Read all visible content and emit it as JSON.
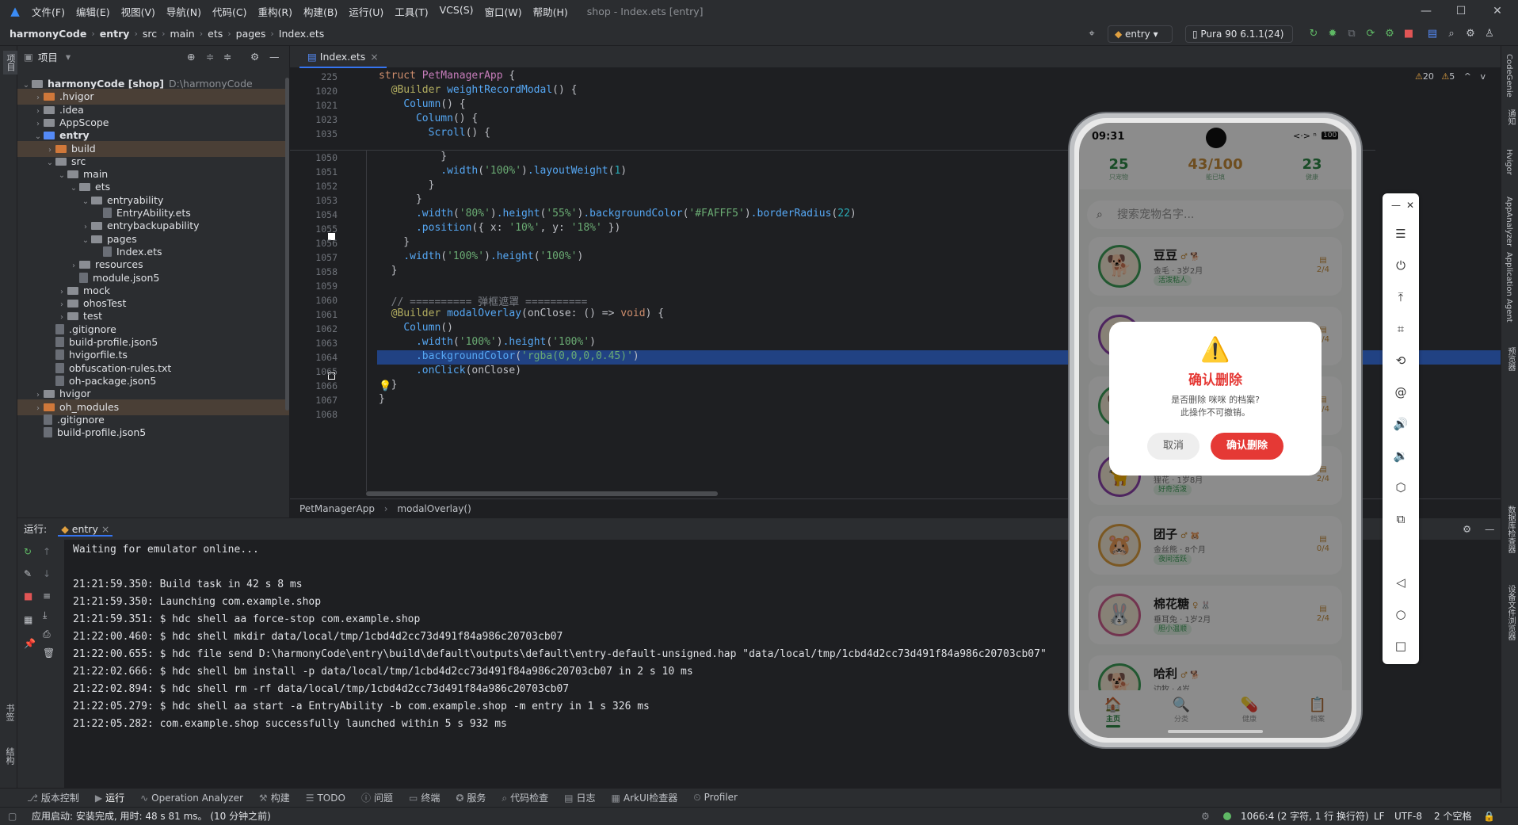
{
  "titlebar": {
    "menus": [
      "文件(F)",
      "编辑(E)",
      "视图(V)",
      "导航(N)",
      "代码(C)",
      "重构(R)",
      "构建(B)",
      "运行(U)",
      "工具(T)",
      "VCS(S)",
      "窗口(W)",
      "帮助(H)"
    ],
    "window_title": "shop - Index.ets [entry]"
  },
  "navbar": {
    "crumbs": [
      "harmonyCode",
      "entry",
      "src",
      "main",
      "ets",
      "pages",
      "Index.ets"
    ],
    "module_select": "entry",
    "device_select": "Pura 90 6.1.1(24)"
  },
  "project": {
    "header": "项目",
    "tree": [
      {
        "label": "harmonyCode [shop]",
        "extra": "D:\\harmonyCode",
        "depth": 0,
        "type": "folder",
        "arrow": "down"
      },
      {
        "label": ".hvigor",
        "depth": 1,
        "type": "folder-orange",
        "arrow": "right",
        "selected": true
      },
      {
        "label": ".idea",
        "depth": 1,
        "type": "folder",
        "arrow": "right"
      },
      {
        "label": "AppScope",
        "depth": 1,
        "type": "folder",
        "arrow": "right"
      },
      {
        "label": "entry",
        "depth": 1,
        "type": "folder-blue",
        "arrow": "down",
        "bold": true
      },
      {
        "label": "build",
        "depth": 2,
        "type": "folder-orange",
        "arrow": "right",
        "selected": true
      },
      {
        "label": "src",
        "depth": 2,
        "type": "folder",
        "arrow": "down"
      },
      {
        "label": "main",
        "depth": 3,
        "type": "folder",
        "arrow": "down"
      },
      {
        "label": "ets",
        "depth": 4,
        "type": "folder",
        "arrow": "down"
      },
      {
        "label": "entryability",
        "depth": 5,
        "type": "folder",
        "arrow": "down"
      },
      {
        "label": "EntryAbility.ets",
        "depth": 6,
        "type": "file",
        "arrow": ""
      },
      {
        "label": "entrybackupability",
        "depth": 5,
        "type": "folder",
        "arrow": "right"
      },
      {
        "label": "pages",
        "depth": 5,
        "type": "folder",
        "arrow": "down"
      },
      {
        "label": "Index.ets",
        "depth": 6,
        "type": "file",
        "arrow": ""
      },
      {
        "label": "resources",
        "depth": 4,
        "type": "folder",
        "arrow": "right"
      },
      {
        "label": "module.json5",
        "depth": 4,
        "type": "file",
        "arrow": ""
      },
      {
        "label": "mock",
        "depth": 3,
        "type": "folder",
        "arrow": "right"
      },
      {
        "label": "ohosTest",
        "depth": 3,
        "type": "folder",
        "arrow": "right"
      },
      {
        "label": "test",
        "depth": 3,
        "type": "folder",
        "arrow": "right"
      },
      {
        "label": ".gitignore",
        "depth": 2,
        "type": "file",
        "arrow": ""
      },
      {
        "label": "build-profile.json5",
        "depth": 2,
        "type": "file",
        "arrow": ""
      },
      {
        "label": "hvigorfile.ts",
        "depth": 2,
        "type": "file",
        "arrow": ""
      },
      {
        "label": "obfuscation-rules.txt",
        "depth": 2,
        "type": "file",
        "arrow": ""
      },
      {
        "label": "oh-package.json5",
        "depth": 2,
        "type": "file",
        "arrow": ""
      },
      {
        "label": "hvigor",
        "depth": 1,
        "type": "folder",
        "arrow": "right"
      },
      {
        "label": "oh_modules",
        "depth": 1,
        "type": "folder-orange",
        "arrow": "right",
        "selected": true
      },
      {
        "label": ".gitignore",
        "depth": 1,
        "type": "file",
        "arrow": ""
      },
      {
        "label": "build-profile.json5",
        "depth": 1,
        "type": "file",
        "arrow": ""
      }
    ]
  },
  "editor": {
    "tab": "Index.ets",
    "inspections": {
      "warnings": "20",
      "weak": "5"
    },
    "sticky": [
      {
        "num": "225",
        "code": "struct PetManagerApp {"
      },
      {
        "num": "1020",
        "code": "  @Builder weightRecordModal() {"
      },
      {
        "num": "1021",
        "code": "    Column() {"
      },
      {
        "num": "1023",
        "code": "      Column() {"
      },
      {
        "num": "1035",
        "code": "        Scroll() {"
      }
    ],
    "lines": [
      {
        "num": "1050",
        "code": "          }"
      },
      {
        "num": "1051",
        "code": "          .width('100%').layoutWeight(1)"
      },
      {
        "num": "1052",
        "code": "        }"
      },
      {
        "num": "1053",
        "code": "      }"
      },
      {
        "num": "1054",
        "code": "      .width('80%').height('55%').backgroundColor('#FAFFF5').borderRadius(22)"
      },
      {
        "num": "1055",
        "code": "      .position({ x: '10%', y: '18%' })"
      },
      {
        "num": "1056",
        "code": "    }"
      },
      {
        "num": "1057",
        "code": "    .width('100%').height('100%')"
      },
      {
        "num": "1058",
        "code": "  }"
      },
      {
        "num": "1059",
        "code": ""
      },
      {
        "num": "1060",
        "code": "  // ========== 弹框遮罩 =========="
      },
      {
        "num": "1061",
        "code": "  @Builder modalOverlay(onClose: () => void) {"
      },
      {
        "num": "1062",
        "code": "    Column()"
      },
      {
        "num": "1063",
        "code": "      .width('100%').height('100%')"
      },
      {
        "num": "1064",
        "code": "      .backgroundColor('rgba(0,0,0,0.45)')"
      },
      {
        "num": "1065",
        "code": "      .onClick(onClose)"
      },
      {
        "num": "1066",
        "code": "  }"
      },
      {
        "num": "1067",
        "code": "}"
      },
      {
        "num": "1068",
        "code": ""
      }
    ],
    "breadcrumb": [
      "PetManagerApp",
      "modalOverlay()"
    ]
  },
  "run": {
    "label": "运行:",
    "config": "entry",
    "console": [
      "Waiting for emulator online...",
      "",
      "21:21:59.350: Build task in 42 s 8 ms",
      "21:21:59.350: Launching com.example.shop",
      "21:21:59.351: $ hdc shell aa force-stop com.example.shop",
      "21:22:00.460: $ hdc shell mkdir data/local/tmp/1cbd4d2cc73d491f84a986c20703cb07",
      "21:22:00.655: $ hdc file send D:\\harmonyCode\\entry\\build\\default\\outputs\\default\\entry-default-unsigned.hap \"data/local/tmp/1cbd4d2cc73d491f84a986c20703cb07\"",
      "21:22:02.666: $ hdc shell bm install -p data/local/tmp/1cbd4d2cc73d491f84a986c20703cb07 in 2 s 10 ms",
      "21:22:02.894: $ hdc shell rm -rf data/local/tmp/1cbd4d2cc73d491f84a986c20703cb07",
      "21:22:05.279: $ hdc shell aa start -a EntryAbility -b com.example.shop -m entry in 1 s 326 ms",
      "21:22:05.282: com.example.shop successfully launched within 5 s 932 ms"
    ]
  },
  "bottombar": {
    "items": [
      "版本控制",
      "运行",
      "Operation Analyzer",
      "构建",
      "TODO",
      "问题",
      "终端",
      "服务",
      "代码检查",
      "日志",
      "ArkUI检查器",
      "Profiler"
    ]
  },
  "statusbar": {
    "message": "应用启动: 安装完成, 用时: 48 s 81 ms。 (10 分钟之前)",
    "position": "1066:4 (2 字符, 1 行 换行符)",
    "line_sep": "LF",
    "encoding": "UTF-8",
    "indent": "2 个空格"
  },
  "left_strip": {
    "top_label": "项目",
    "bottom_labels": [
      "书签",
      "结构"
    ]
  },
  "right_strip": {
    "labels": [
      "CodeGenie",
      "通知",
      "Hvigor",
      "AppAnalyzer",
      "Application Agent",
      "预览器",
      "数据库检查器",
      "设备文件浏览器"
    ]
  },
  "phone": {
    "time": "09:31",
    "battery": "100",
    "stats": [
      {
        "value": "25",
        "label": "只宠物"
      },
      {
        "value": "43/100",
        "label": "能已填"
      },
      {
        "value": "23",
        "label": "健康"
      }
    ],
    "search_placeholder": "搜索宠物名字...",
    "pets": [
      {
        "name": "豆豆",
        "icons": "♂ 🐕",
        "sub": "金毛 · 3岁2月",
        "tag": "活泼粘人",
        "count": "2/4",
        "emoji": "🐕"
      },
      {
        "name": "",
        "icons": "",
        "sub": "",
        "tag": "",
        "count": "1/4",
        "emoji": "🐈"
      },
      {
        "name": "",
        "icons": "",
        "sub": "",
        "tag": "",
        "count": "3/4",
        "emoji": "🐕"
      },
      {
        "name": "",
        "icons": "",
        "sub": "狸花 · 1岁8月",
        "tag": "好奇活泼",
        "count": "2/4",
        "emoji": "🐈"
      },
      {
        "name": "团子",
        "icons": "♂ 🐹",
        "sub": "金丝熊 · 8个月",
        "tag": "夜间活跃",
        "count": "0/4",
        "emoji": "🐹"
      },
      {
        "name": "棉花糖",
        "icons": "♀ 🐰",
        "sub": "垂耳兔 · 1岁2月",
        "tag": "胆小温顺",
        "count": "2/4",
        "emoji": "🐰"
      },
      {
        "name": "哈利",
        "icons": "♂ 🐕",
        "sub": "边牧 · 4岁",
        "tag": "",
        "count": "",
        "emoji": "🐕"
      }
    ],
    "tabs": [
      {
        "label": "主页",
        "icon": "🏠",
        "active": true
      },
      {
        "label": "分类",
        "icon": "🔍",
        "active": false
      },
      {
        "label": "健康",
        "icon": "💊",
        "active": false
      },
      {
        "label": "档案",
        "icon": "📋",
        "active": false
      }
    ],
    "dialog": {
      "icon": "⚠️",
      "title": "确认删除",
      "message": "是否删除 咪咪 的档案?",
      "message2": "此操作不可撤销。",
      "cancel": "取消",
      "confirm": "确认删除"
    }
  },
  "colors": {
    "accent": "#3574f0",
    "danger": "#e53935",
    "pet_green": "#2e8b47",
    "stat_orange": "#c98e3b"
  }
}
